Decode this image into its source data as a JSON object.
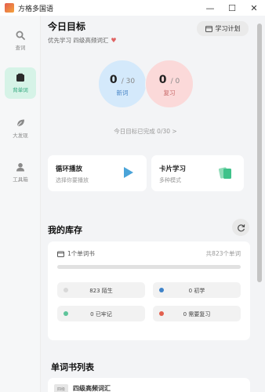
{
  "window": {
    "title": "方格多国语",
    "controls": {
      "minimize": "—",
      "maximize": "☐",
      "close": "✕"
    }
  },
  "sidebar": {
    "items": [
      {
        "label": "查词",
        "icon": "search-icon",
        "active": false
      },
      {
        "label": "背单词",
        "icon": "book-icon",
        "active": true
      },
      {
        "label": "大发现",
        "icon": "leaf-icon",
        "active": false
      },
      {
        "label": "工具箱",
        "icon": "user-icon",
        "active": false
      }
    ]
  },
  "today": {
    "title": "今日目标",
    "subtitle": "优先学习 四级高频词汇",
    "plan_button": "学习计划",
    "new_words": {
      "done": "0",
      "total": "/ 30",
      "label": "新词"
    },
    "review": {
      "done": "0",
      "total": "/ 0",
      "label": "复习"
    },
    "progress_text": "今日目标已完成 0/30 >"
  },
  "modes": {
    "loop": {
      "title": "循环播放",
      "subtitle": "选择你要播放"
    },
    "flash": {
      "title": "卡片学习",
      "subtitle": "多种模式"
    }
  },
  "library": {
    "title": "我的库存",
    "books_count": "1个单词书",
    "total": "共823个单词",
    "stats": [
      {
        "text": "823 陌生",
        "color": "#d8d8d8"
      },
      {
        "text": "0 初学",
        "color": "#3f83c9"
      },
      {
        "text": "0 已牢记",
        "color": "#5ec49a"
      },
      {
        "text": "0 需要复习",
        "color": "#e2604f"
      }
    ]
  },
  "book_list": {
    "title": "单词书列表",
    "items": [
      {
        "name": "四级高频词汇",
        "cover": "四级"
      }
    ]
  },
  "colors": {
    "accent": "#2aa579",
    "new_bg": "#d4e9fb",
    "review_bg": "#fbd9d9"
  }
}
